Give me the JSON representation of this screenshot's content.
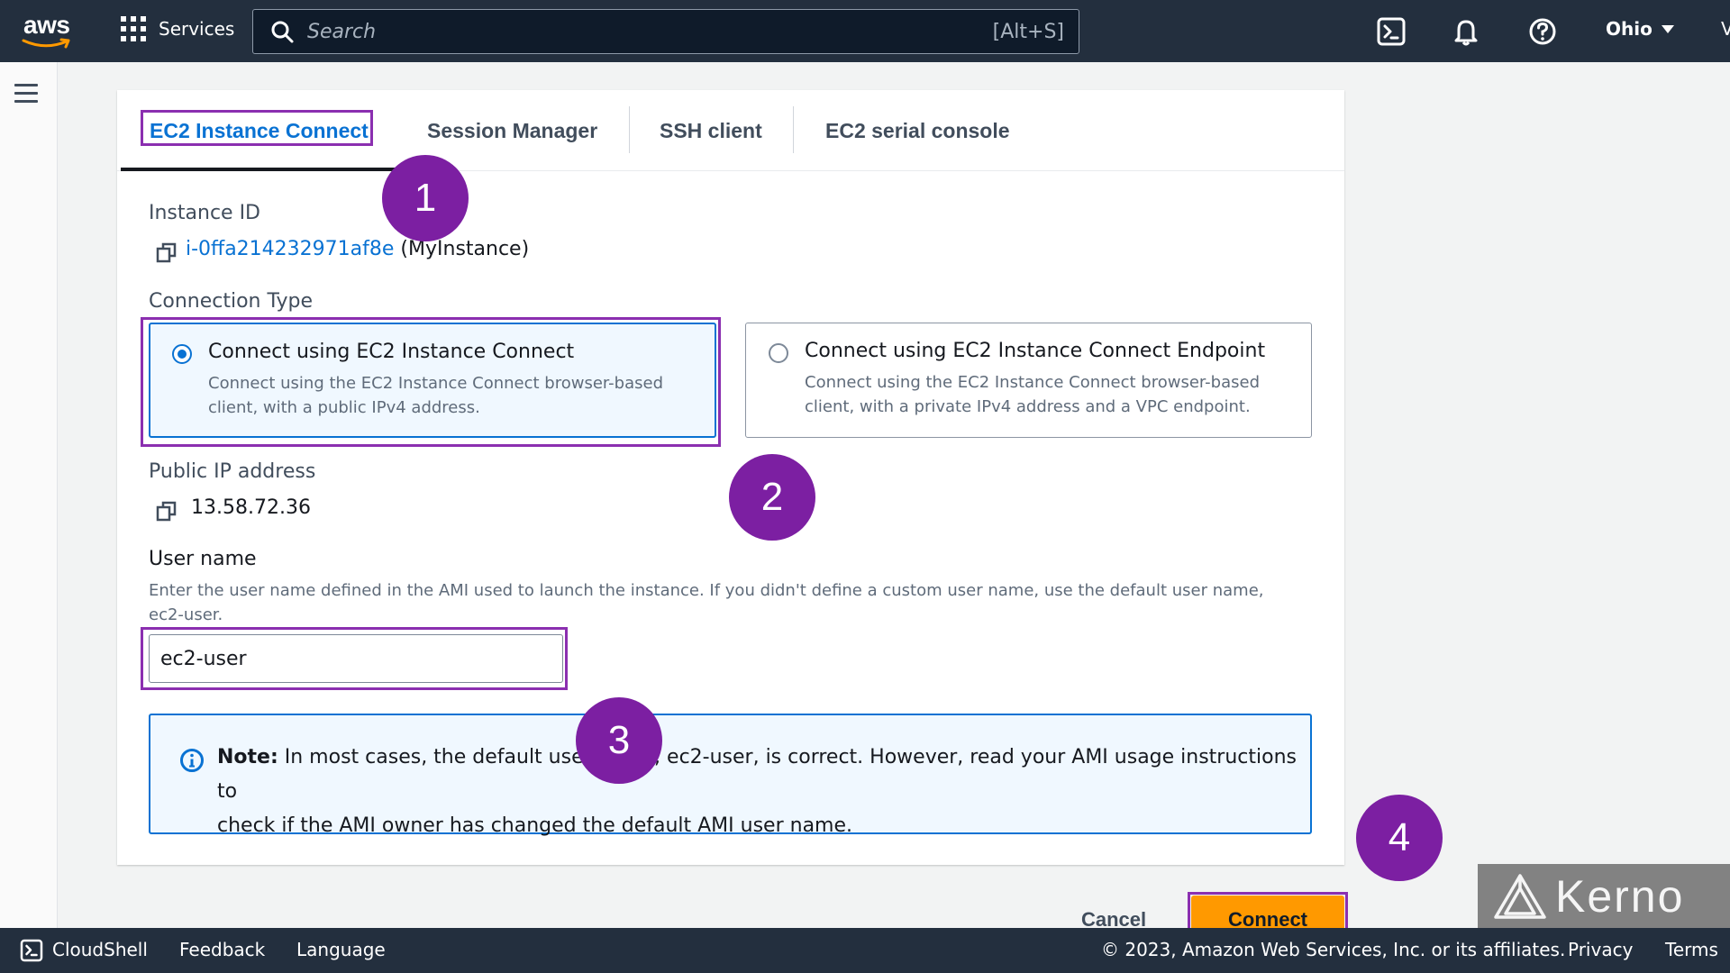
{
  "topnav": {
    "logo_text": "aws",
    "services_label": "Services",
    "search_placeholder": "Search",
    "search_shortcut": "[Alt+S]",
    "region": "Ohio",
    "edge_text": "V"
  },
  "tabs": [
    {
      "label": "EC2 Instance Connect",
      "active": true
    },
    {
      "label": "Session Manager",
      "active": false
    },
    {
      "label": "SSH client",
      "active": false
    },
    {
      "label": "EC2 serial console",
      "active": false
    }
  ],
  "instance": {
    "label": "Instance ID",
    "id": "i-0ffa214232971af8e",
    "name": "(MyInstance)"
  },
  "connection_type": {
    "label": "Connection Type",
    "options": [
      {
        "title": "Connect using EC2 Instance Connect",
        "desc_line1": "Connect using the EC2 Instance Connect browser-based",
        "desc_line2": "client, with a public IPv4 address.",
        "selected": true
      },
      {
        "title": "Connect using EC2 Instance Connect Endpoint",
        "desc_line1": "Connect using the EC2 Instance Connect browser-based",
        "desc_line2": "client, with a private IPv4 address and a VPC endpoint.",
        "selected": false
      }
    ]
  },
  "public_ip": {
    "label": "Public IP address",
    "value": "13.58.72.36"
  },
  "username": {
    "label": "User name",
    "desc_line1": "Enter the user name defined in the AMI used to launch the instance. If you didn't define a custom user name, use the default user name,",
    "desc_line2": "ec2-user.",
    "value": "ec2-user"
  },
  "note": {
    "bold": "Note:",
    "line1": " In most cases, the default user name, ec2-user, is correct. However, read your AMI usage instructions to",
    "line2": "check if the AMI owner has changed the default AMI user name."
  },
  "actions": {
    "cancel": "Cancel",
    "connect": "Connect"
  },
  "badges": [
    "1",
    "2",
    "3",
    "4"
  ],
  "footer": {
    "cloudshell": "CloudShell",
    "feedback": "Feedback",
    "language": "Language",
    "copyright": "© 2023, Amazon Web Services, Inc. or its affiliates.",
    "privacy": "Privacy",
    "terms": "Terms"
  },
  "watermark": "Kerno",
  "colors": {
    "nav_bg": "#232f3e",
    "link_blue": "#0972d3",
    "primary_orange": "#ff9900",
    "annotation_purple": "#7c1fa2"
  },
  "icons": [
    "aws-smile-icon",
    "apps-grid-icon",
    "search-icon",
    "cloudshell-icon",
    "bell-icon",
    "help-icon",
    "hamburger-icon",
    "copy-icon",
    "info-icon",
    "kerno-logo-icon"
  ]
}
